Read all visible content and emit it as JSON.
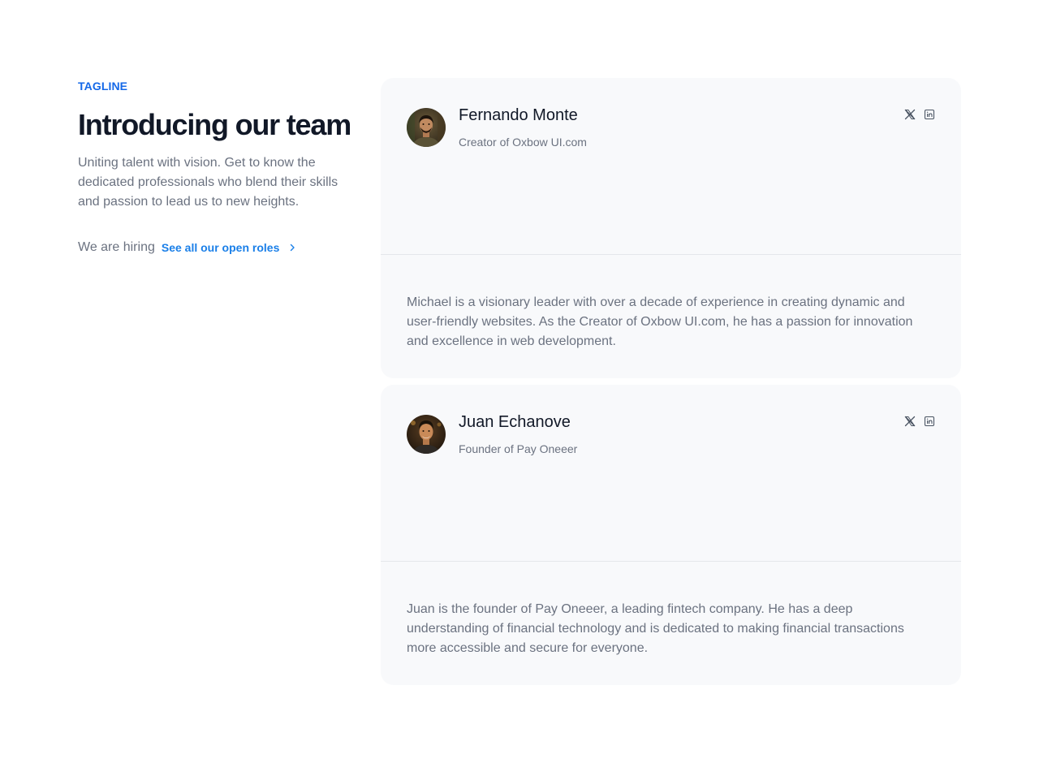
{
  "intro": {
    "tagline": "TAGLINE",
    "heading": "Introducing our team",
    "description": "Uniting talent with vision. Get to know the dedicated professionals who blend their skills and passion to lead us to new heights.",
    "hiring_label": "We are hiring",
    "open_roles_link": "See all our open roles"
  },
  "team": [
    {
      "name": "Fernando Monte",
      "role": "Creator of Oxbow UI.com",
      "bio": "Michael is a visionary leader with over a decade of experience in creating dynamic and user-friendly websites. As the Creator of Oxbow UI.com, he has a passion for innovation and excellence in web development.",
      "socials": [
        "x-icon",
        "linkedin-icon"
      ]
    },
    {
      "name": "Juan Echanove",
      "role": "Founder of Pay Oneeer",
      "bio": "Juan is the founder of Pay Oneeer, a leading fintech company. He has a deep understanding of financial technology and is dedicated to making financial transactions more accessible and secure for everyone.",
      "socials": [
        "x-icon",
        "linkedin-icon"
      ]
    }
  ],
  "colors": {
    "accent": "#1468e8",
    "link": "#1a7fe8",
    "card_bg": "#f8f9fb",
    "heading": "#111827",
    "muted": "#6b7280"
  }
}
